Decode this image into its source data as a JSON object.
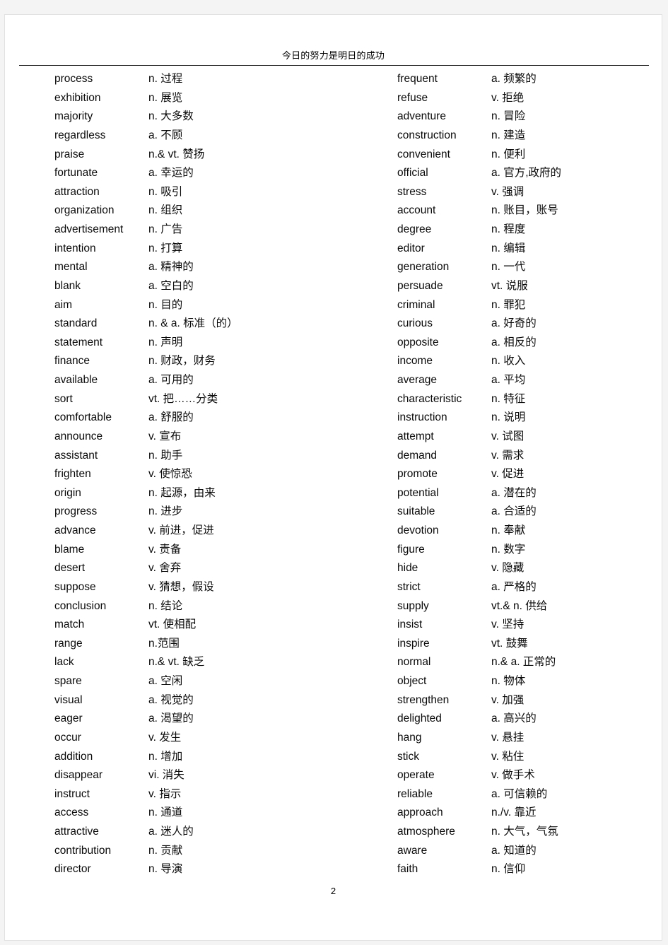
{
  "document": {
    "header_title": "今日的努力是明日的成功",
    "page_number": "2"
  },
  "columns": {
    "left": [
      {
        "word": "process",
        "definition": "n. 过程"
      },
      {
        "word": "exhibition",
        "definition": "n. 展览"
      },
      {
        "word": "majority",
        "definition": "n. 大多数"
      },
      {
        "word": "regardless",
        "definition": "a. 不顾"
      },
      {
        "word": "praise",
        "definition": "n.& vt. 赞扬"
      },
      {
        "word": "fortunate",
        "definition": "a. 幸运的"
      },
      {
        "word": "attraction",
        "definition": "n. 吸引"
      },
      {
        "word": "organization",
        "definition": "n. 组织"
      },
      {
        "word": "advertisement",
        "definition": "n. 广告"
      },
      {
        "word": "intention",
        "definition": "n. 打算"
      },
      {
        "word": "mental",
        "definition": "a. 精神的"
      },
      {
        "word": "blank",
        "definition": "a. 空白的"
      },
      {
        "word": "aim",
        "definition": "n. 目的"
      },
      {
        "word": "standard",
        "definition": "n. & a. 标准（的）"
      },
      {
        "word": "statement",
        "definition": "n. 声明"
      },
      {
        "word": "finance",
        "definition": "n. 财政，财务"
      },
      {
        "word": "available",
        "definition": "a. 可用的"
      },
      {
        "word": "sort",
        "definition": "vt. 把……分类"
      },
      {
        "word": "comfortable",
        "definition": "a. 舒服的"
      },
      {
        "word": "announce",
        "definition": "v. 宣布"
      },
      {
        "word": "assistant",
        "definition": "n. 助手"
      },
      {
        "word": "frighten",
        "definition": "v. 使惊恐"
      },
      {
        "word": "origin",
        "definition": "n. 起源，由来"
      },
      {
        "word": "progress",
        "definition": "n. 进步"
      },
      {
        "word": "advance",
        "definition": "v. 前进，促进"
      },
      {
        "word": "blame",
        "definition": "v. 责备"
      },
      {
        "word": "desert",
        "definition": "v. 舍弃"
      },
      {
        "word": "suppose",
        "definition": "v. 猜想，假设"
      },
      {
        "word": "conclusion",
        "definition": "n. 结论"
      },
      {
        "word": "match",
        "definition": "vt. 使相配"
      },
      {
        "word": "range",
        "definition": "n.范围"
      },
      {
        "word": "lack",
        "definition": "n.& vt. 缺乏"
      },
      {
        "word": "spare",
        "definition": "a. 空闲"
      },
      {
        "word": "visual",
        "definition": "a. 视觉的"
      },
      {
        "word": "eager",
        "definition": "a. 渴望的"
      },
      {
        "word": "occur",
        "definition": "v. 发生"
      },
      {
        "word": "addition",
        "definition": "n. 增加"
      },
      {
        "word": "disappear",
        "definition": "vi. 消失"
      },
      {
        "word": "instruct",
        "definition": "v. 指示"
      },
      {
        "word": "access",
        "definition": "n. 通道"
      },
      {
        "word": "attractive",
        "definition": "a. 迷人的"
      },
      {
        "word": "contribution",
        "definition": "n. 贡献"
      },
      {
        "word": "director",
        "definition": "n. 导演"
      }
    ],
    "right": [
      {
        "word": "frequent",
        "definition": "a. 频繁的"
      },
      {
        "word": "refuse",
        "definition": "v. 拒绝"
      },
      {
        "word": "adventure",
        "definition": "n. 冒险"
      },
      {
        "word": "construction",
        "definition": "n. 建造"
      },
      {
        "word": "convenient",
        "definition": "n. 便利"
      },
      {
        "word": "official",
        "definition": "a. 官方,政府的"
      },
      {
        "word": "stress",
        "definition": "v. 强调"
      },
      {
        "word": "account",
        "definition": "n. 账目，账号"
      },
      {
        "word": "degree",
        "definition": "n. 程度"
      },
      {
        "word": "editor",
        "definition": "n. 编辑"
      },
      {
        "word": "generation",
        "definition": "n. 一代"
      },
      {
        "word": "persuade",
        "definition": "vt. 说服"
      },
      {
        "word": "criminal",
        "definition": "n. 罪犯"
      },
      {
        "word": "curious",
        "definition": "a. 好奇的"
      },
      {
        "word": "opposite",
        "definition": "a. 相反的"
      },
      {
        "word": "income",
        "definition": "n. 收入"
      },
      {
        "word": "average",
        "definition": "a. 平均"
      },
      {
        "word": "characteristic",
        "definition": "n. 特征"
      },
      {
        "word": "instruction",
        "definition": "n. 说明"
      },
      {
        "word": "attempt",
        "definition": "v. 试图"
      },
      {
        "word": "demand",
        "definition": "v. 需求"
      },
      {
        "word": "promote",
        "definition": "v. 促进"
      },
      {
        "word": "potential",
        "definition": "a. 潜在的"
      },
      {
        "word": "suitable",
        "definition": "a. 合适的"
      },
      {
        "word": "devotion",
        "definition": "n. 奉献"
      },
      {
        "word": "figure",
        "definition": "n. 数字"
      },
      {
        "word": "hide",
        "definition": "v. 隐藏"
      },
      {
        "word": "strict",
        "definition": "a. 严格的"
      },
      {
        "word": "supply",
        "definition": "vt.& n. 供给"
      },
      {
        "word": "insist",
        "definition": "v. 坚持"
      },
      {
        "word": "inspire",
        "definition": "vt. 鼓舞"
      },
      {
        "word": "normal",
        "definition": "n.& a. 正常的"
      },
      {
        "word": "object",
        "definition": "n. 物体"
      },
      {
        "word": "strengthen",
        "definition": "v. 加强"
      },
      {
        "word": "delighted",
        "definition": "a. 高兴的"
      },
      {
        "word": "hang",
        "definition": "v. 悬挂"
      },
      {
        "word": "stick",
        "definition": "v. 粘住"
      },
      {
        "word": "operate",
        "definition": "v. 做手术"
      },
      {
        "word": "reliable",
        "definition": "a. 可信赖的"
      },
      {
        "word": "approach",
        "definition": "n./v. 靠近"
      },
      {
        "word": "atmosphere",
        "definition": "n. 大气，气氛"
      },
      {
        "word": "aware",
        "definition": "a. 知道的"
      },
      {
        "word": "faith",
        "definition": "n. 信仰"
      }
    ]
  }
}
